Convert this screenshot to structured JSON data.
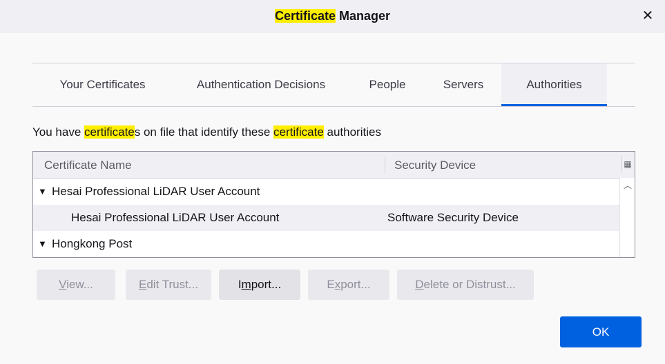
{
  "window": {
    "title_highlight": "Certificate",
    "title_rest": " Manager",
    "close_glyph": "✕"
  },
  "tabs": [
    {
      "label": "Your Certificates",
      "active": false
    },
    {
      "label": "Authentication Decisions",
      "active": false
    },
    {
      "label": "People",
      "active": false
    },
    {
      "label": "Servers",
      "active": false
    },
    {
      "label": "Authorities",
      "active": true
    }
  ],
  "description": {
    "part1": "You have ",
    "hl1": "certificate",
    "part2": "s on file that identify these ",
    "hl2": "certificate",
    "part3": " authorities"
  },
  "tree": {
    "columns": {
      "name": "Certificate Name",
      "device": "Security Device"
    },
    "rows": [
      {
        "type": "group",
        "label": "Hesai Professional LiDAR User Account",
        "device": ""
      },
      {
        "type": "child",
        "label": "Hesai Professional LiDAR User Account",
        "device": "Software Security Device"
      },
      {
        "type": "group",
        "label": "Hongkong Post",
        "device": ""
      }
    ]
  },
  "buttons": {
    "view": {
      "pre": "",
      "key": "V",
      "post": "iew..."
    },
    "edit_trust": {
      "pre": "",
      "key": "E",
      "post": "dit Trust..."
    },
    "import": {
      "pre": "I",
      "key": "m",
      "post": "port..."
    },
    "export": {
      "pre": "E",
      "key": "x",
      "post": "port..."
    },
    "delete": {
      "pre": "",
      "key": "D",
      "post": "elete or Distrust..."
    },
    "ok": "OK"
  },
  "colors": {
    "accent": "#0061e0",
    "highlight": "#ffee00"
  }
}
